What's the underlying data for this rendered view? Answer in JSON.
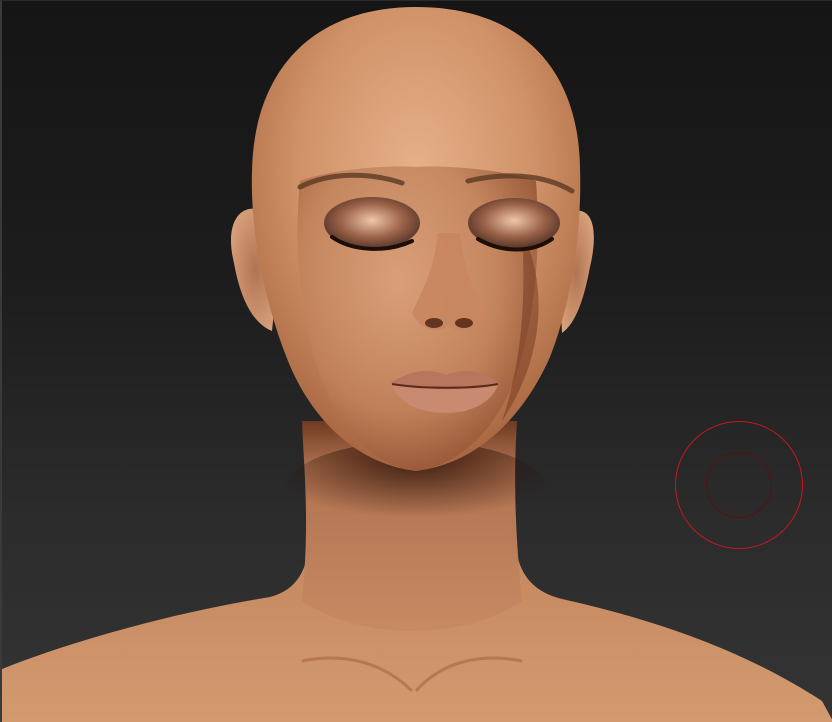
{
  "viewport": {
    "background_top": "#151515",
    "background_bottom": "#343434",
    "model": {
      "skin_base": "#c88a62",
      "skin_highlight": "#e2ab84",
      "skin_shadow": "#7a4026",
      "lip_color": "#b9765e",
      "eyeshadow_color": "#4a2c22"
    },
    "brush_cursor": {
      "outer_color": "#c8181c",
      "inner_color": "#5a1010"
    }
  }
}
